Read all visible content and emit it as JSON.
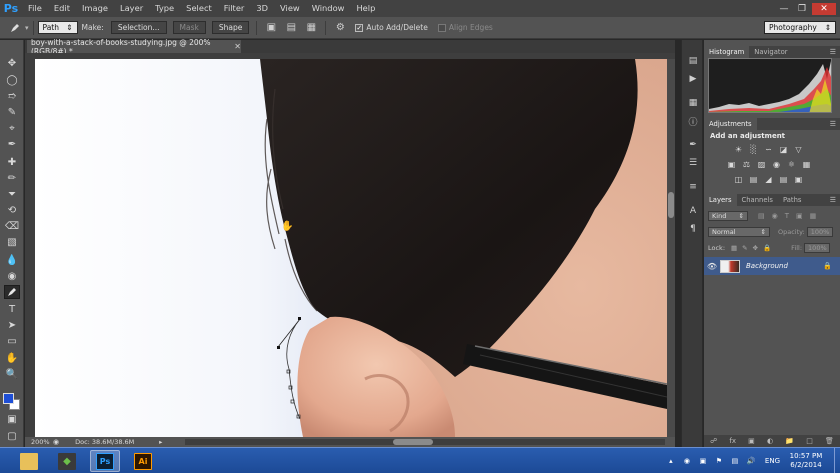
{
  "app": {
    "logo": "Ps",
    "menu": [
      "File",
      "Edit",
      "Image",
      "Layer",
      "Type",
      "Select",
      "Filter",
      "3D",
      "View",
      "Window",
      "Help"
    ],
    "window_controls": [
      "minimize",
      "restore",
      "close"
    ]
  },
  "options_bar": {
    "tool_mode_value": "Path",
    "make_label": "Make:",
    "selection_button": "Selection...",
    "mask_button": "Mask",
    "shape_button": "Shape",
    "auto_add_delete": {
      "label": "Auto Add/Delete",
      "checked": true
    },
    "align_edges": {
      "label": "Align Edges",
      "checked": false
    },
    "workspace": "Photography"
  },
  "document": {
    "tab_title": "boy-with-a-stack-of-books-studying.jpg @ 200% (RGB/8#) *",
    "zoom": "200%",
    "doc_info": "Doc: 38.6M/38.6M"
  },
  "panels": {
    "top_tabs": [
      "Histogram",
      "Navigator"
    ],
    "adjustments_tab": "Adjustments",
    "adjustments_title": "Add an adjustment",
    "layers_tabs": [
      "Layers",
      "Channels",
      "Paths"
    ],
    "kind_filter": "Kind",
    "blend_mode": "Normal",
    "opacity_label": "Opacity:",
    "opacity_value": "100%",
    "lock_label": "Lock:",
    "fill_label": "Fill:",
    "fill_value": "100%",
    "layer_name": "Background"
  },
  "taskbar": {
    "apps": [
      "file-explorer",
      "app-icon",
      "photoshop",
      "illustrator"
    ],
    "ps_label": "Ps",
    "ai_label": "Ai",
    "language": "ENG",
    "time": "10:57 PM",
    "date": "6/2/2014"
  },
  "colors": {
    "foreground": "#1f4fd6",
    "background": "#ffffff",
    "selected_layer": "#3f5b8c",
    "taskbar": "#1c4a96"
  }
}
